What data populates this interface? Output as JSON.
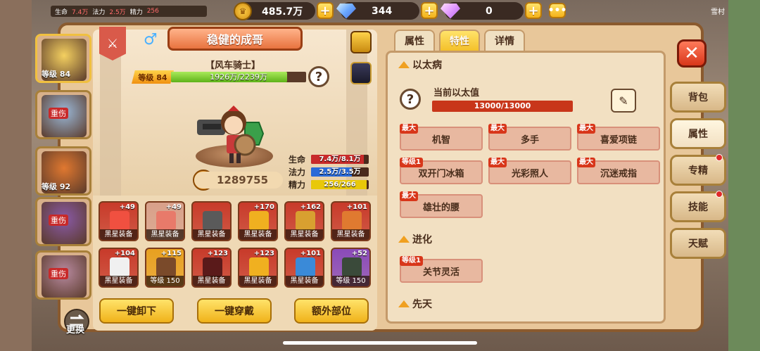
{
  "hud": {
    "hp_label": "生命",
    "hp_value": "7.4万",
    "mp_label": "法力",
    "mp_value": "2.5万",
    "sp_label": "精力",
    "sp_value": "256"
  },
  "currency": {
    "gold": "485.7万",
    "diamond": "344",
    "pink_gem": "0"
  },
  "village_label": "雪村",
  "hero": {
    "name": "稳健的成哥",
    "title": "【风车骑士】",
    "level_tag": "等级 84",
    "xp_text": "1926万/2239万",
    "xp_fraction": 0.86,
    "power": "1289755",
    "stats": [
      {
        "label": "生命",
        "value": "7.4万/8.1万",
        "fraction": 0.91,
        "color": "#c82a2a"
      },
      {
        "label": "法力",
        "value": "2.5万/3.5万",
        "fraction": 0.71,
        "color": "#2a6ad8"
      },
      {
        "label": "精力",
        "value": "256/266",
        "fraction": 0.96,
        "color": "#e8c80a"
      }
    ]
  },
  "portraits": [
    {
      "level": "等级 84",
      "wound": "",
      "color": "#f4d060"
    },
    {
      "level": "",
      "wound": "重伤",
      "color": "#9ab8d8"
    },
    {
      "level": "等级 92",
      "wound": "",
      "color": "#e07830"
    },
    {
      "level": "",
      "wound": "重伤",
      "color": "#8a5aa8"
    },
    {
      "level": "",
      "wound": "重伤",
      "color": "#b88aa0"
    }
  ],
  "swap_label": "更换",
  "equipment": [
    {
      "plus": "+49",
      "label": "黑星装备",
      "bg": "#c83a2a",
      "art": "#f05040"
    },
    {
      "plus": "+49",
      "label": "黑星装备",
      "bg": "#d8a08a",
      "art": "#e87a6a"
    },
    {
      "plus": "",
      "label": "黑星装备",
      "bg": "#c83a2a",
      "art": "#5a5a5a"
    },
    {
      "plus": "+170",
      "label": "黑星装备",
      "bg": "#c83a2a",
      "art": "#f0b020"
    },
    {
      "plus": "+162",
      "label": "黑星装备",
      "bg": "#c83a2a",
      "art": "#d8a030"
    },
    {
      "plus": "+101",
      "label": "黑星装备",
      "bg": "#c83a2a",
      "art": "#e07a30"
    },
    {
      "plus": "+104",
      "label": "黑星装备",
      "bg": "#c83a2a",
      "art": "#f0f0f0"
    },
    {
      "plus": "+115",
      "label": "等级 150",
      "bg": "#e8a020",
      "art": "#7a4a2a"
    },
    {
      "plus": "+123",
      "label": "黑星装备",
      "bg": "#c83a2a",
      "art": "#5a1a1a"
    },
    {
      "plus": "+123",
      "label": "黑星装备",
      "bg": "#c83a2a",
      "art": "#f0b020"
    },
    {
      "plus": "+101",
      "label": "黑星装备",
      "bg": "#c83a2a",
      "art": "#3a8ad8"
    },
    {
      "plus": "+52",
      "label": "等级 150",
      "bg": "#8a4ab8",
      "art": "#3a4a3a"
    }
  ],
  "actions": {
    "unequip_all": "一键卸下",
    "equip_all": "一键穿戴",
    "extra_slots": "额外部位"
  },
  "tabs": [
    "属性",
    "特性",
    "详情"
  ],
  "active_tab": 1,
  "sections": {
    "ether": "以太病",
    "evolution": "进化",
    "innate": "先天"
  },
  "ether_current_label": "当前以太值",
  "ether_value": "13000/13000",
  "traits": [
    {
      "tag": "最大",
      "name": "机智"
    },
    {
      "tag": "最大",
      "name": "多手"
    },
    {
      "tag": "最大",
      "name": "喜爱项链"
    },
    {
      "tag": "等级1",
      "name": "双开门冰箱"
    },
    {
      "tag": "最大",
      "name": "光彩照人"
    },
    {
      "tag": "最大",
      "name": "沉迷戒指"
    },
    {
      "tag": "最大",
      "name": "雄壮的腰"
    }
  ],
  "evolution_traits": [
    {
      "tag": "等级1",
      "name": "关节灵活"
    }
  ],
  "side_tabs": [
    {
      "label": "背包",
      "dot": false
    },
    {
      "label": "属性",
      "dot": false
    },
    {
      "label": "专精",
      "dot": true
    },
    {
      "label": "技能",
      "dot": true
    },
    {
      "label": "天赋",
      "dot": false
    }
  ],
  "active_side_tab": 1
}
